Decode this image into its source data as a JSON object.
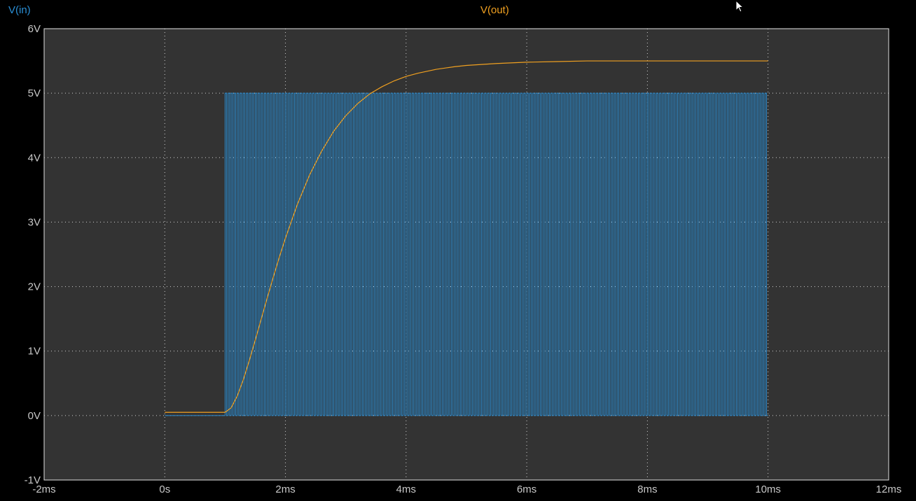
{
  "chart_data": {
    "type": "line",
    "xlabel": "",
    "ylabel": "",
    "xlim": [
      -2,
      12
    ],
    "ylim": [
      -1,
      6
    ],
    "x_unit": "ms",
    "grid": true,
    "background_color": "#333333",
    "x_ticks": [
      {
        "value": -2,
        "label": "-2ms"
      },
      {
        "value": 0,
        "label": "0s"
      },
      {
        "value": 2,
        "label": "2ms"
      },
      {
        "value": 4,
        "label": "4ms"
      },
      {
        "value": 6,
        "label": "6ms"
      },
      {
        "value": 8,
        "label": "8ms"
      },
      {
        "value": 10,
        "label": "10ms"
      },
      {
        "value": 12,
        "label": "12ms"
      }
    ],
    "y_ticks": [
      {
        "value": 6,
        "label": "6V"
      },
      {
        "value": 5,
        "label": "5V"
      },
      {
        "value": 4,
        "label": "4V"
      },
      {
        "value": 3,
        "label": "3V"
      },
      {
        "value": 2,
        "label": "2V"
      },
      {
        "value": 1,
        "label": "1V"
      },
      {
        "value": 0,
        "label": "0V"
      },
      {
        "value": -1,
        "label": "-1V"
      }
    ],
    "series": [
      {
        "name": "V(in)",
        "color": "#2a8fd6",
        "kind": "square_wave",
        "x_start": 0,
        "x_end": 10,
        "pulse_start": 1,
        "low_value": 0,
        "high_value": 5,
        "period": 0.05,
        "duty_cycle": 0.5
      },
      {
        "name": "V(out)",
        "color": "#f0a020",
        "x": [
          0,
          1.0,
          1.1,
          1.2,
          1.3,
          1.4,
          1.5,
          1.6,
          1.7,
          1.8,
          1.9,
          2.0,
          2.2,
          2.4,
          2.6,
          2.8,
          3.0,
          3.2,
          3.4,
          3.6,
          3.8,
          4.0,
          4.2,
          4.5,
          4.8,
          5.0,
          5.5,
          6.0,
          6.5,
          7.0,
          8.0,
          9.0,
          10.0
        ],
        "values": [
          0.05,
          0.05,
          0.12,
          0.3,
          0.55,
          0.85,
          1.17,
          1.5,
          1.83,
          2.15,
          2.46,
          2.75,
          3.28,
          3.73,
          4.1,
          4.41,
          4.65,
          4.84,
          4.99,
          5.1,
          5.19,
          5.26,
          5.31,
          5.37,
          5.41,
          5.43,
          5.46,
          5.48,
          5.49,
          5.5,
          5.5,
          5.5,
          5.5
        ]
      }
    ]
  },
  "trace_labels": {
    "vin": "V(in)",
    "vout": "V(out)"
  },
  "colors": {
    "axis_text": "#c8c8c8",
    "grid": "#d0d0d0",
    "vin": "#2a8fd6",
    "vout": "#f0a020"
  },
  "icons": {
    "cursor": "mouse-pointer-icon"
  }
}
